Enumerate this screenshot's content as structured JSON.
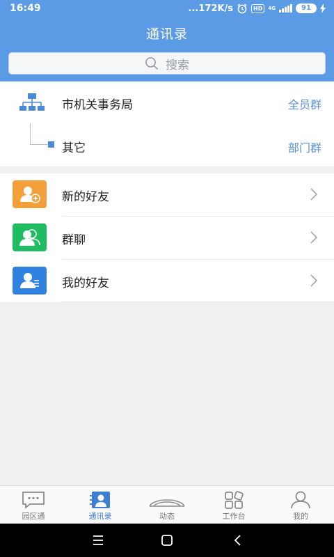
{
  "status": {
    "time": "16:49",
    "net_speed": "...172K/s",
    "hd_badge": "HD",
    "net_type": "4G",
    "battery": "91"
  },
  "header": {
    "title": "通讯录",
    "search_placeholder": "搜索"
  },
  "org": {
    "root_name": "市机关事务局",
    "root_link": "全员群",
    "child_name": "其它",
    "child_link": "部门群"
  },
  "list": {
    "items": [
      {
        "label": "新的好友",
        "icon": "add-friend-icon",
        "color": "#f4a03a"
      },
      {
        "label": "群聊",
        "icon": "group-chat-icon",
        "color": "#1fbd62"
      },
      {
        "label": "我的好友",
        "icon": "friends-icon",
        "color": "#2f82e0"
      }
    ]
  },
  "tabs": [
    {
      "label": "园区通",
      "icon": "chat-bubble-icon",
      "active": false
    },
    {
      "label": "通讯录",
      "icon": "contacts-icon",
      "active": true
    },
    {
      "label": "动态",
      "icon": "feed-icon",
      "active": false
    },
    {
      "label": "工作台",
      "icon": "apps-grid-icon",
      "active": false
    },
    {
      "label": "我的",
      "icon": "profile-icon",
      "active": false
    }
  ],
  "colors": {
    "header": "#5b9be6",
    "accent": "#3f7fd2",
    "link": "#5b8fd4"
  }
}
